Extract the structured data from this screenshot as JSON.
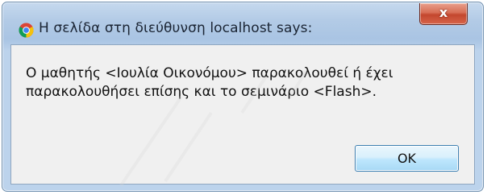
{
  "dialog": {
    "title": "Η σελίδα στη διεύθυνση localhost says:",
    "message": "Ο μαθητής <Ιουλία Οικονόμου> παρακολουθεί ή έχει\nπαρακολουθήσει επίσης και το σεμινάριο <Flash>.",
    "ok_label": "OK",
    "close_label": "x"
  },
  "icons": {
    "app": "chrome-icon",
    "close": "close-icon"
  },
  "colors": {
    "title_bar": "#b3cbe6",
    "close_button": "#c3472e",
    "ok_button": "#bee6fd",
    "content_background": "#f0f0f0"
  }
}
